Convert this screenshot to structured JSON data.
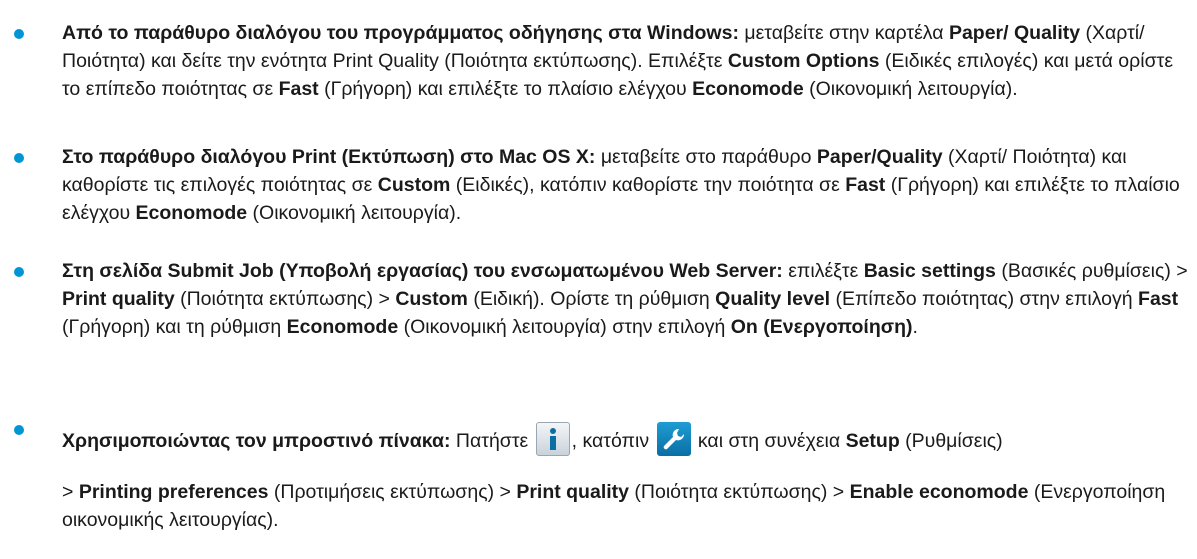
{
  "accent_color": "#0096d6",
  "items": [
    {
      "bold_1": "Από το παράθυρο διαλόγου του προγράμματος οδήγησης στα Windows:",
      "t_1": " μεταβείτε στην καρτέλα ",
      "bold_2": "Paper/ Quality",
      "t_2": " (Χαρτί/Ποιότητα) και δείτε την ενότητα Print Quality (Ποιότητα εκτύπωσης). Επιλέξτε ",
      "bold_3": "Custom Options",
      "t_3": " (Ειδικές επιλογές) και μετά ορίστε το επίπεδο ποιότητας σε ",
      "bold_4": "Fast",
      "t_4": " (Γρήγορη) και επιλέξτε το πλαίσιο ελέγχου ",
      "bold_5": "Economode",
      "t_5": " (Οικονομική λειτουργία)."
    },
    {
      "bold_1": "Στο παράθυρο διαλόγου Print (Εκτύπωση) στο Mac OS X:",
      "t_1": " μεταβείτε στο παράθυρο ",
      "bold_2": "Paper/Quality",
      "t_2": " (Χαρτί/ Ποιότητα) και καθορίστε τις επιλογές ποιότητας σε ",
      "bold_3": "Custom",
      "t_3": " (Ειδικές), κατόπιν καθορίστε την ποιότητα σε ",
      "bold_4": "Fast",
      "t_4": " (Γρήγορη) και επιλέξτε το πλαίσιο ελέγχου ",
      "bold_5": "Economode",
      "t_5": " (Οικονομική λειτουργία)."
    },
    {
      "bold_1": "Στη σελίδα Submit Job (Υποβολή εργασίας) του ενσωματωμένου Web Server:",
      "t_1": " επιλέξτε ",
      "bold_2": "Basic settings",
      "t_2": " (Βασικές ρυθμίσεις) > ",
      "bold_3": "Print quality",
      "t_3": " (Ποιότητα εκτύπωσης) > ",
      "bold_4": "Custom",
      "t_4": " (Ειδική). Ορίστε τη ρύθμιση ",
      "bold_5": "Quality level",
      "t_5": " (Επίπεδο ποιότητας) στην επιλογή ",
      "bold_6": "Fast",
      "t_6": " (Γρήγορη) και τη ρύθμιση ",
      "bold_7": "Economode",
      "t_7": " (Οικονομική λειτουργία) στην επιλογή ",
      "bold_8": "On (Ενεργοποίηση)",
      "t_8": "."
    },
    {
      "bold_1": "Χρησιμοποιώντας τον μπροστινό πίνακα:",
      "t_1": " Πατήστε ",
      "icon_1": "info-icon",
      "t_2": ", κατόπιν ",
      "icon_2": "wrench-icon",
      "t_3": " και στη συνέχεια ",
      "bold_2": "Setup",
      "t_4": " (Ρυθμίσεις)",
      "t_5": "> ",
      "bold_3": "Printing preferences",
      "t_6": " (Προτιμήσεις εκτύπωσης) > ",
      "bold_4": "Print quality",
      "t_7": " (Ποιότητα εκτύπωσης) > ",
      "bold_5": "Enable economode",
      "t_8": " (Ενεργοποίηση οικονομικής λειτουργίας)."
    }
  ]
}
